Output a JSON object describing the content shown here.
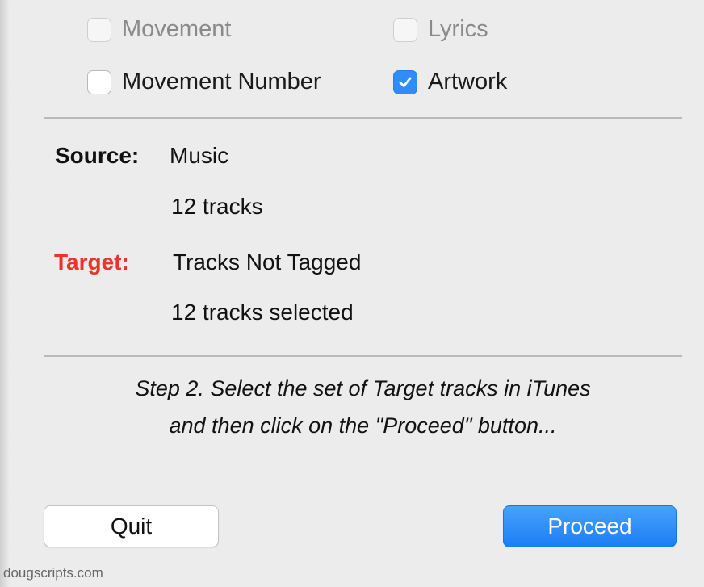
{
  "options": {
    "movement": {
      "label": "Movement",
      "checked": false
    },
    "lyrics": {
      "label": "Lyrics",
      "checked": false
    },
    "movement_number": {
      "label": "Movement Number",
      "checked": false
    },
    "artwork": {
      "label": "Artwork",
      "checked": true
    }
  },
  "source": {
    "label": "Source:",
    "value": "Music",
    "track_count": "12 tracks"
  },
  "target": {
    "label": "Target:",
    "value": "Tracks Not Tagged",
    "selection": "12 tracks selected",
    "label_color": "#e8342a"
  },
  "instructions": {
    "line1": "Step 2. Select the set of Target tracks in iTunes",
    "line2": "and then click on the \"Proceed\" button..."
  },
  "buttons": {
    "quit": "Quit",
    "proceed": "Proceed"
  },
  "watermark": "dougscripts.com",
  "colors": {
    "accent": "#2f8dfa",
    "background": "#ececec"
  }
}
